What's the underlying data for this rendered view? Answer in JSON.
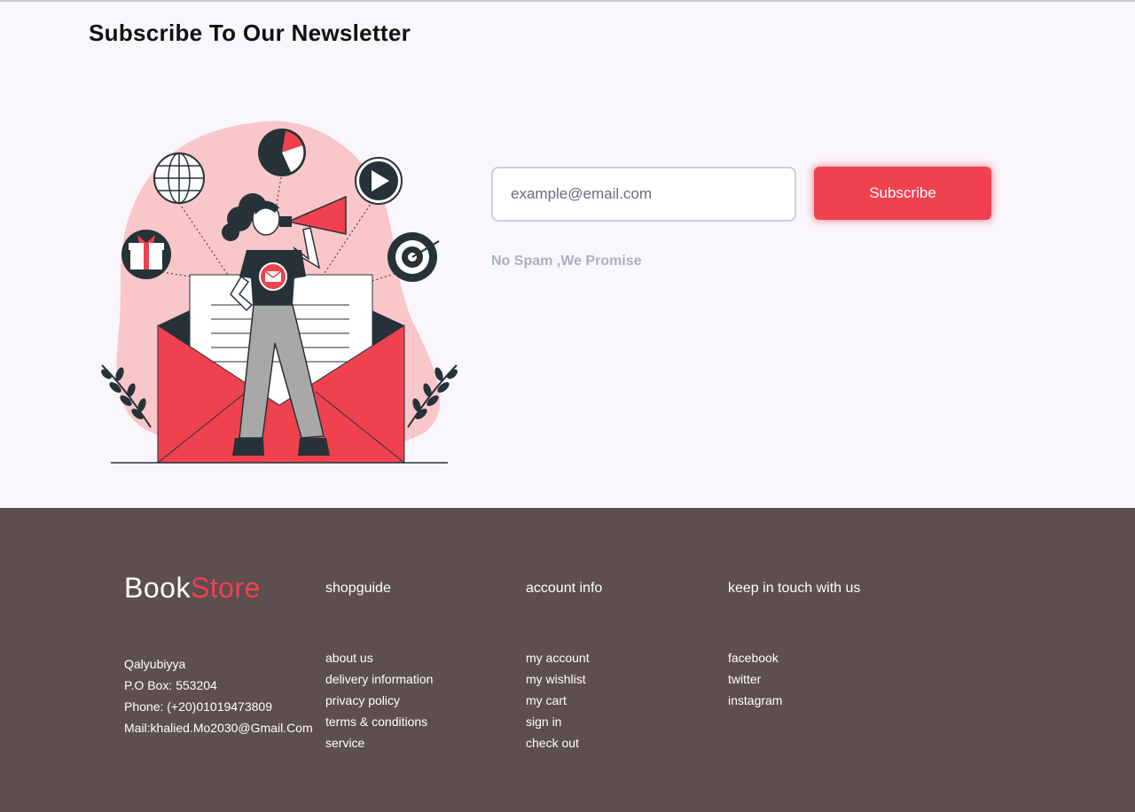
{
  "newsletter": {
    "title": "Subscribe To Our Newsletter",
    "email_placeholder": "example@email.com",
    "subscribe_label": "Subscribe",
    "no_spam": "No Spam ,We Promise"
  },
  "colors": {
    "accent": "#f0414f",
    "footer_bg": "#5d4e4f",
    "page_bg": "#f9f6fc",
    "muted_text": "#a7b1c3"
  },
  "footer": {
    "brand_part1": "Book",
    "brand_part2": "Store",
    "contact": [
      "Qalyubiyya",
      "P.O Box: 553204",
      "Phone: (+20)01019473809",
      "Mail:khalied.Mo2030@Gmail.Com"
    ],
    "shopguide": {
      "title": "shopguide",
      "items": [
        "about us",
        "delivery information",
        "privacy policy",
        "terms & conditions",
        "service"
      ]
    },
    "account": {
      "title": "account info",
      "items": [
        "my account",
        "my wishlist",
        "my cart",
        "sign in",
        "check out"
      ]
    },
    "social": {
      "title": "keep in touch with us",
      "items": [
        "facebook",
        "twitter",
        "instagram"
      ]
    }
  }
}
